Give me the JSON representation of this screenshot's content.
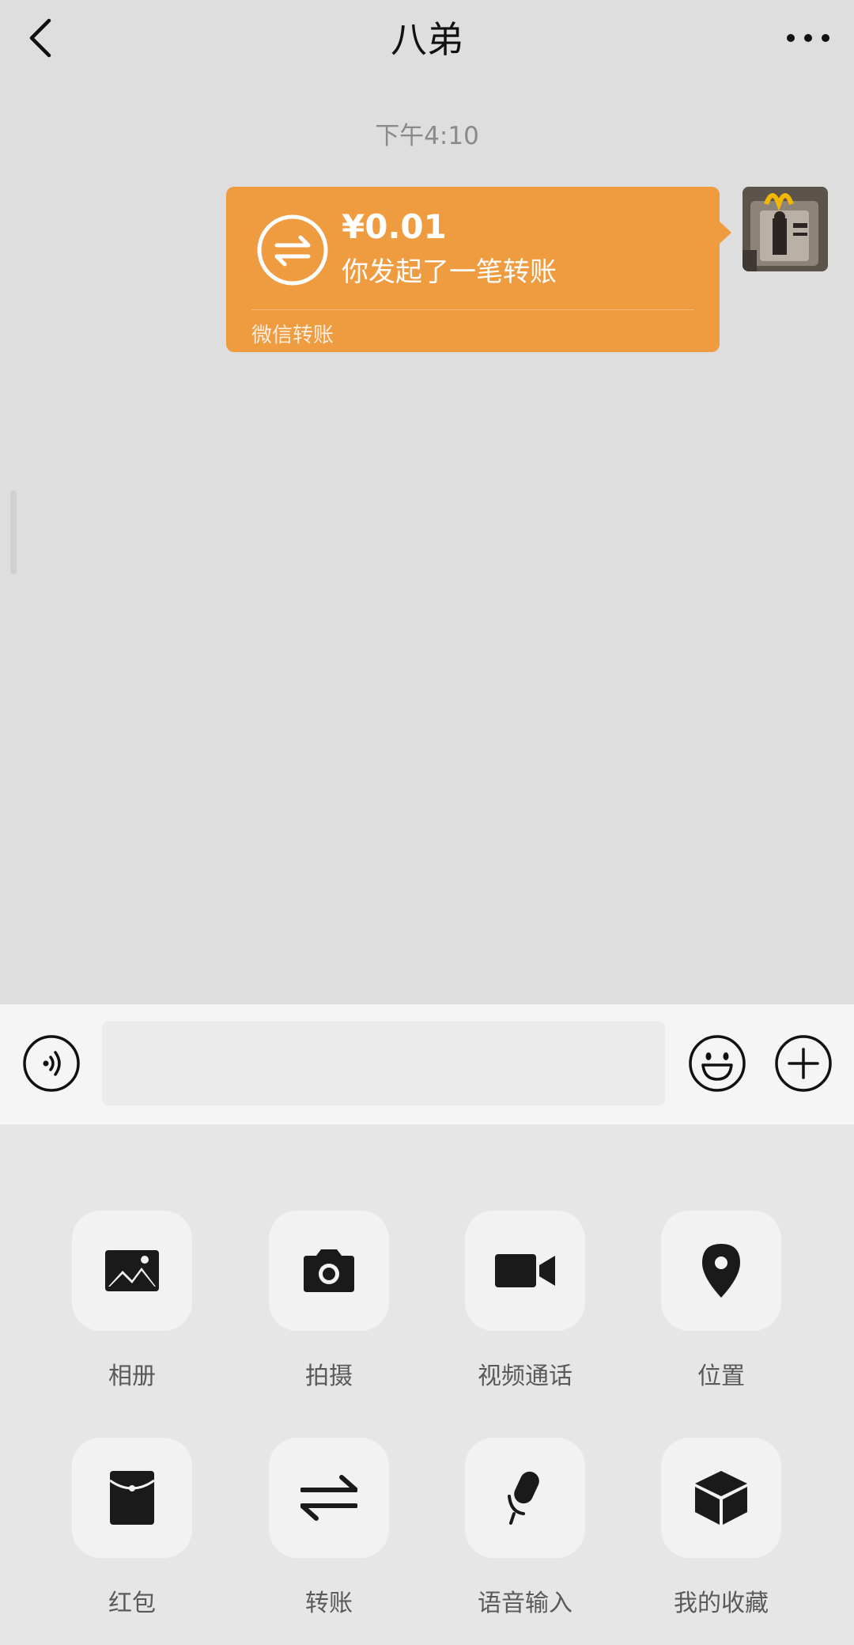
{
  "header": {
    "title": "八弟",
    "back_icon": "chevron-left-icon",
    "more_icon": "more-dots-icon"
  },
  "chat": {
    "timestamp": "下午4:10",
    "messages": [
      {
        "type": "transfer",
        "amount": "¥0.01",
        "description": "你发起了一笔转账",
        "footer": "微信转账",
        "icon": "transfer-arrows-icon",
        "color": "#ef9b40"
      }
    ]
  },
  "input_bar": {
    "voice_icon": "voice-icon",
    "text_value": "",
    "emoji_icon": "emoji-icon",
    "plus_icon": "plus-icon"
  },
  "panel": {
    "items": [
      {
        "label": "相册",
        "icon": "photo-album-icon"
      },
      {
        "label": "拍摄",
        "icon": "camera-icon"
      },
      {
        "label": "视频通话",
        "icon": "video-call-icon"
      },
      {
        "label": "位置",
        "icon": "location-pin-icon"
      },
      {
        "label": "红包",
        "icon": "red-packet-icon"
      },
      {
        "label": "转账",
        "icon": "transfer-icon"
      },
      {
        "label": "语音输入",
        "icon": "microphone-icon"
      },
      {
        "label": "我的收藏",
        "icon": "favorites-box-icon"
      }
    ]
  }
}
